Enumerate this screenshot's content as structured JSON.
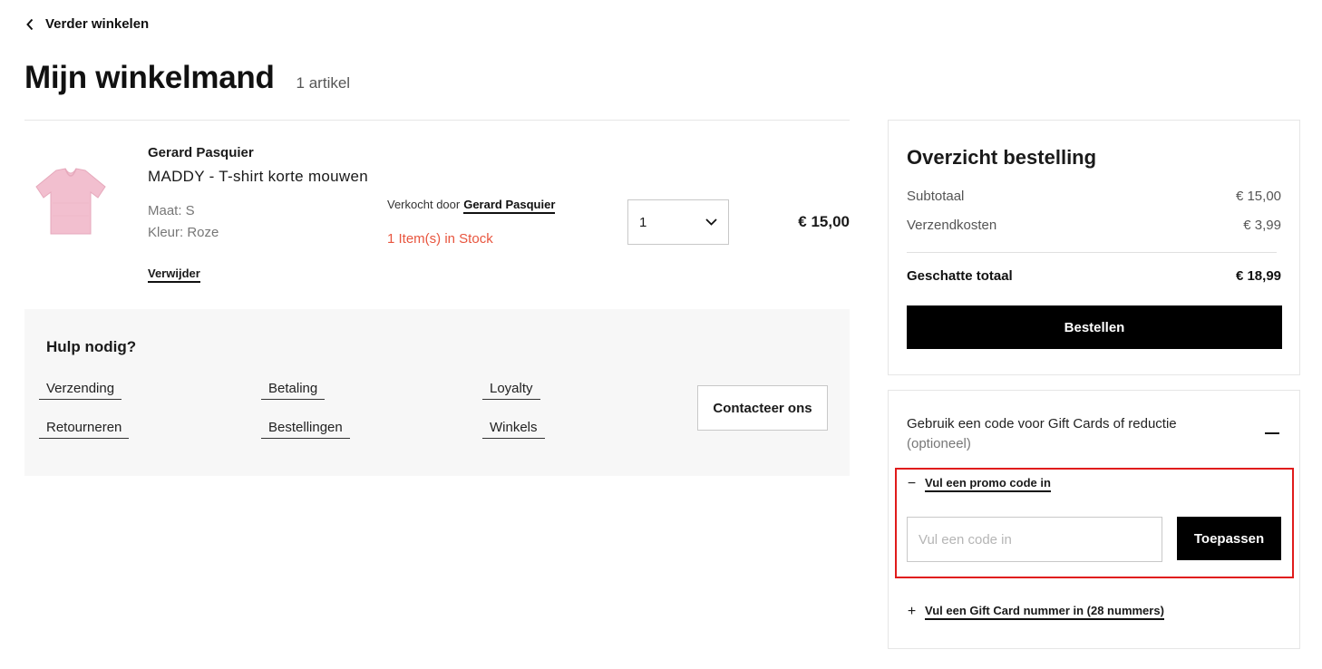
{
  "nav": {
    "back_label": "Verder winkelen"
  },
  "cart": {
    "title": "Mijn winkelmand",
    "count": "1 artikel"
  },
  "item": {
    "brand": "Gerard Pasquier",
    "name": "MADDY - T-shirt korte mouwen",
    "size": "Maat: S",
    "color": "Kleur: Roze",
    "remove_label": "Verwijder",
    "sold_by_prefix": "Verkocht door",
    "seller": "Gerard Pasquier",
    "stock": "1 Item(s) in Stock",
    "quantity": "1",
    "price": "€ 15,00",
    "image_color": "#f2bfcf"
  },
  "help": {
    "title": "Hulp nodig?",
    "links": [
      "Verzending",
      "Betaling",
      "Loyalty",
      "Retourneren",
      "Bestellingen",
      "Winkels"
    ],
    "contact_label": "Contacteer ons"
  },
  "summary": {
    "title": "Overzicht bestelling",
    "subtotal_label": "Subtotaal",
    "subtotal_value": "€ 15,00",
    "shipping_label": "Verzendkosten",
    "shipping_value": "€ 3,99",
    "total_label": "Geschatte totaal",
    "total_value": "€ 18,99",
    "order_button": "Bestellen"
  },
  "promo": {
    "heading": "Gebruik een code voor Gift Cards of reductie",
    "optional": "(optioneel)",
    "promo_toggle_symbol": "−",
    "promo_toggle_label": "Vul een promo code in",
    "code_placeholder": "Vul een code in",
    "apply_label": "Toepassen",
    "giftcard_toggle_symbol": "+",
    "giftcard_toggle_label": "Vul een Gift Card nummer in (28 nummers)"
  },
  "colors": {
    "accent": "#000000",
    "stock": "#e8553e",
    "highlight": "#e01b1b",
    "help_bg": "#f7f7f7"
  }
}
